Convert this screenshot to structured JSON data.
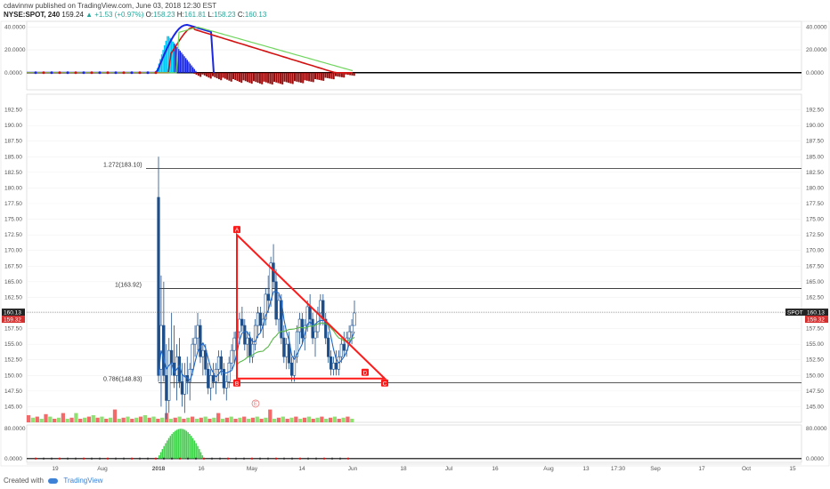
{
  "header": {
    "published_line": "cdavinnw published on TradingView.com, June 03, 2018 12:30 EST",
    "symbol": "NYSE:SPOT, 240",
    "last": "159.24",
    "change": "▲ +1.53 (+0.97%)",
    "open_label": "O:",
    "open": "158.23",
    "high_label": "H:",
    "high": "161.81",
    "low_label": "L:",
    "low": "158.23",
    "close_label": "C:",
    "close": "160.13"
  },
  "footer": {
    "created_with": "Created with",
    "brand": "TradingView"
  },
  "colors": {
    "up_candle": "#1e4f8a",
    "wick": "#1e4f8a",
    "pattern": "#ff1a1a",
    "ma_blue": "#1f66c4",
    "ma_green": "#59b84a",
    "volume_up": "#7ddb5a",
    "volume_down": "#f05050",
    "osc_blue": "#1a28e6",
    "osc_red": "#d21212",
    "osc_green": "#6fd55d",
    "cyan_hist": "#00c6f2",
    "dark_red_hist": "#9b0b0b",
    "bottom_green": "#3fd04a"
  },
  "chart_data": [
    {
      "type": "line",
      "panel": "top-oscillator",
      "yticks": [
        "40.0000",
        "20.0000",
        "0.0000"
      ],
      "ylim": [
        -15,
        45
      ],
      "series": []
    },
    {
      "type": "candlestick",
      "panel": "main-price",
      "ylim": [
        142.5,
        195
      ],
      "yticks": [
        "192.50",
        "190.00",
        "187.50",
        "185.00",
        "182.50",
        "180.00",
        "177.50",
        "175.00",
        "172.50",
        "170.00",
        "167.50",
        "165.00",
        "162.50",
        "160.00",
        "157.50",
        "155.00",
        "152.50",
        "150.00",
        "147.50",
        "145.00"
      ],
      "xticks": [
        "19",
        "Aug",
        "2018",
        "16",
        "May",
        "14",
        "Jun",
        "18",
        "Jul",
        "16",
        "Aug",
        "13",
        "17:30",
        "Sep",
        "17",
        "Oct",
        "15"
      ],
      "fib_levels": [
        {
          "label": "1.272(183.10)",
          "value": 183.1
        },
        {
          "label": "1(163.92)",
          "value": 163.92
        },
        {
          "label": "0.786(148.83)",
          "value": 148.83
        }
      ],
      "pattern_points": [
        {
          "label": "A",
          "price": 172.5
        },
        {
          "label": "B",
          "price": 149.5
        },
        {
          "label": "C",
          "price": 149.5
        },
        {
          "label": "D",
          "price": 150.5
        },
        {
          "label": "E",
          "price": 145.5
        }
      ],
      "price_tags": {
        "left_top": "160.13",
        "left_bottom": "159.32",
        "symbol_tag": "SPOT",
        "right_top": "160.13",
        "right_bottom": "159.32"
      },
      "candles": [
        [
          178.5,
          185,
          149,
          150
        ],
        [
          151,
          166,
          145,
          158
        ],
        [
          158,
          165,
          149,
          150
        ],
        [
          150,
          155,
          143,
          146
        ],
        [
          146,
          156,
          144,
          154
        ],
        [
          154,
          160,
          150,
          152
        ],
        [
          152,
          158,
          148,
          150
        ],
        [
          150,
          155,
          146,
          153
        ],
        [
          153,
          156,
          148,
          149
        ],
        [
          149,
          152,
          145,
          147
        ],
        [
          147,
          152,
          144,
          150
        ],
        [
          150,
          153,
          147,
          149
        ],
        [
          149,
          152,
          146,
          151
        ],
        [
          151,
          156,
          150,
          155
        ],
        [
          155,
          158,
          153,
          156
        ],
        [
          156,
          160,
          154,
          158
        ],
        [
          158,
          159,
          152,
          153
        ],
        [
          153,
          155,
          150,
          154
        ],
        [
          154,
          155,
          150,
          151
        ],
        [
          151,
          152,
          147,
          148
        ],
        [
          148,
          151,
          146,
          150
        ],
        [
          150,
          152,
          148,
          149
        ],
        [
          149,
          152,
          147,
          151
        ],
        [
          151,
          154,
          149,
          153
        ],
        [
          153,
          154,
          150,
          151
        ],
        [
          151,
          152,
          147,
          148
        ],
        [
          148,
          150,
          146,
          149
        ],
        [
          149,
          153,
          148,
          152
        ],
        [
          152,
          155,
          151,
          154
        ],
        [
          154,
          157,
          152,
          156
        ],
        [
          156,
          158,
          154,
          157
        ],
        [
          157,
          160,
          155,
          159
        ],
        [
          159,
          161,
          157,
          158
        ],
        [
          158,
          159,
          154,
          155
        ],
        [
          155,
          157,
          153,
          156
        ],
        [
          156,
          157,
          152,
          153
        ],
        [
          153,
          156,
          152,
          155
        ],
        [
          155,
          159,
          154,
          158
        ],
        [
          158,
          161,
          156,
          160
        ],
        [
          160,
          161,
          157,
          158
        ],
        [
          158,
          160,
          156,
          159
        ],
        [
          159,
          164,
          158,
          163
        ],
        [
          163,
          166,
          160,
          162
        ],
        [
          162,
          169,
          161,
          168
        ],
        [
          168,
          171,
          164,
          165
        ],
        [
          165,
          167,
          158,
          159
        ],
        [
          159,
          163,
          157,
          162
        ],
        [
          162,
          163,
          155,
          156
        ],
        [
          156,
          158,
          152,
          153
        ],
        [
          153,
          156,
          151,
          155
        ],
        [
          155,
          157,
          151,
          152
        ],
        [
          152,
          153,
          149,
          150
        ],
        [
          150,
          154,
          149,
          153
        ],
        [
          153,
          158,
          152,
          157
        ],
        [
          157,
          160,
          155,
          159
        ],
        [
          159,
          160,
          155,
          156
        ],
        [
          156,
          159,
          154,
          158
        ],
        [
          158,
          162,
          157,
          161
        ],
        [
          161,
          163,
          158,
          159
        ],
        [
          159,
          160,
          155,
          156
        ],
        [
          156,
          158,
          153,
          157
        ],
        [
          157,
          161,
          156,
          160
        ],
        [
          160,
          163,
          158,
          162
        ],
        [
          162,
          163,
          158,
          159
        ],
        [
          159,
          160,
          155,
          156
        ],
        [
          156,
          157,
          152,
          153
        ],
        [
          153,
          154,
          150,
          151
        ],
        [
          151,
          153,
          150,
          152
        ],
        [
          152,
          154,
          150,
          151
        ],
        [
          151,
          154,
          150,
          153
        ],
        [
          153,
          156,
          152,
          155
        ],
        [
          155,
          157,
          153,
          154
        ],
        [
          154,
          157,
          153,
          156
        ],
        [
          156,
          158,
          155,
          157
        ],
        [
          157,
          159,
          155,
          158
        ],
        [
          158,
          162,
          158,
          160
        ]
      ]
    },
    {
      "type": "bar",
      "panel": "volume-overlay",
      "note": "relative volume, visible at bottom of main panel",
      "values": [
        2,
        1,
        1,
        1,
        2,
        1,
        1,
        1,
        2,
        1,
        1,
        2,
        1,
        1,
        1,
        2,
        1,
        1,
        1,
        1,
        3,
        1,
        1,
        1,
        1,
        1,
        1,
        2,
        1,
        1,
        1,
        1,
        2,
        1,
        1,
        1,
        1,
        1,
        1,
        1,
        1,
        1,
        1,
        1,
        2,
        1,
        1,
        1,
        1,
        1,
        1,
        1,
        1,
        1,
        1,
        1,
        3,
        1,
        1,
        1,
        1,
        1,
        1,
        1,
        1,
        1,
        1,
        1,
        1,
        1,
        1,
        1,
        1,
        1,
        1,
        1
      ]
    },
    {
      "type": "bar",
      "panel": "bottom-oscillator",
      "yticks": [
        "80.0000",
        "0.0000"
      ],
      "ylim": [
        -10,
        90
      ]
    }
  ]
}
